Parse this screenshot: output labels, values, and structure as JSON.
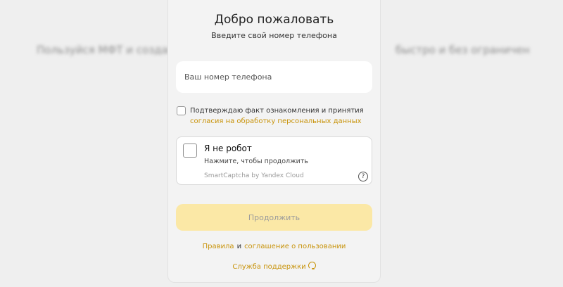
{
  "background": {
    "blurred_left": "Пользуйся МФТ и создавай сделки",
    "blurred_right": "быстро и без ограничений"
  },
  "card": {
    "title": "Добро пожаловать",
    "subtitle": "Введите свой номер телефона",
    "phone_placeholder": "Ваш номер телефона",
    "consent_text": "Подтверждаю факт ознакомления и принятия",
    "consent_link": "согласия на обработку персональных данных",
    "captcha": {
      "title": "Я не робот",
      "hint": "Нажмите, чтобы продолжить",
      "brand": "SmartCaptcha by Yandex Cloud",
      "help_icon": "?"
    },
    "continue_label": "Продолжить",
    "terms": {
      "rules": "Правила",
      "and": "и",
      "agreement": "соглашение о пользовании"
    },
    "support_label": "Служба поддержки"
  },
  "colors": {
    "accent": "#c8930a",
    "button_disabled": "#fbe8a6",
    "background": "#efefef",
    "card": "#f3f3f3"
  }
}
